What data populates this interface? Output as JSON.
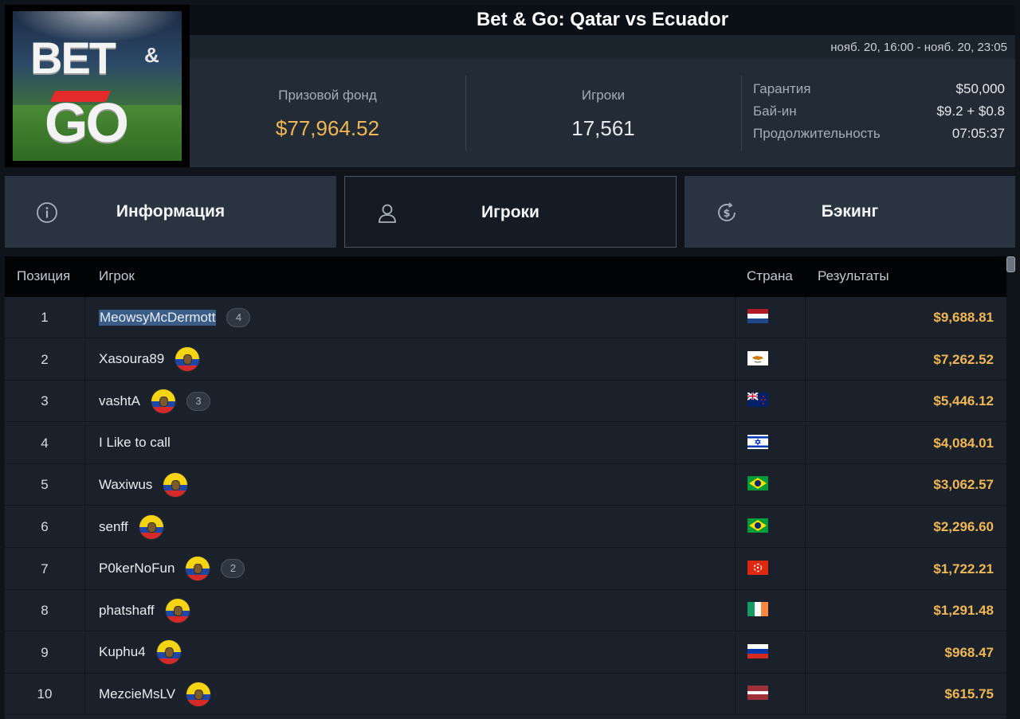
{
  "logo": {
    "text_bet": "BET",
    "text_amp": "&",
    "text_go": "GO"
  },
  "header": {
    "title": "Bet & Go: Qatar vs Ecuador",
    "date_range": "нояб. 20, 16:00 - нояб. 20, 23:05"
  },
  "stats": {
    "prize_label": "Призовой фонд",
    "prize_value": "$77,964.52",
    "players_label": "Игроки",
    "players_value": "17,561",
    "guarantee_label": "Гарантия",
    "guarantee_value": "$50,000",
    "buyin_label": "Бай-ин",
    "buyin_value": "$9.2 + $0.8",
    "duration_label": "Продолжительность",
    "duration_value": "07:05:37"
  },
  "tabs": [
    {
      "label": "Информация",
      "icon": "info-icon"
    },
    {
      "label": "Игроки",
      "icon": "user-icon",
      "active": true
    },
    {
      "label": "Бэкинг",
      "icon": "dollar-cycle-icon"
    }
  ],
  "table": {
    "headers": {
      "position": "Позиция",
      "player": "Игрок",
      "country": "Страна",
      "results": "Результаты"
    },
    "rows": [
      {
        "pos": "1",
        "name": "MeowsyMcDermott",
        "ecuador": false,
        "badge": "4",
        "flag": "netherlands",
        "result": "$9,688.81"
      },
      {
        "pos": "2",
        "name": "Xasoura89",
        "ecuador": true,
        "badge": "",
        "flag": "cyprus",
        "result": "$7,262.52"
      },
      {
        "pos": "3",
        "name": "vashtA",
        "ecuador": true,
        "badge": "3",
        "flag": "new-zealand",
        "result": "$5,446.12"
      },
      {
        "pos": "4",
        "name": "I Like to call",
        "ecuador": false,
        "badge": "",
        "flag": "israel",
        "result": "$4,084.01"
      },
      {
        "pos": "5",
        "name": "Waxiwus",
        "ecuador": true,
        "badge": "",
        "flag": "brazil",
        "result": "$3,062.57"
      },
      {
        "pos": "6",
        "name": "senff",
        "ecuador": true,
        "badge": "",
        "flag": "brazil",
        "result": "$2,296.60"
      },
      {
        "pos": "7",
        "name": "P0kerNoFun",
        "ecuador": true,
        "badge": "2",
        "flag": "hong-kong",
        "result": "$1,722.21"
      },
      {
        "pos": "8",
        "name": "phatshaff",
        "ecuador": true,
        "badge": "",
        "flag": "ireland",
        "result": "$1,291.48"
      },
      {
        "pos": "9",
        "name": "Kuphu4",
        "ecuador": true,
        "badge": "",
        "flag": "russia",
        "result": "$968.47"
      },
      {
        "pos": "10",
        "name": "MezcieMsLV",
        "ecuador": true,
        "badge": "",
        "flag": "latvia",
        "result": "$615.75"
      }
    ]
  },
  "colors": {
    "accent_gold": "#f0b753",
    "background": "#0f141b",
    "row_bg": "#1a212b"
  }
}
